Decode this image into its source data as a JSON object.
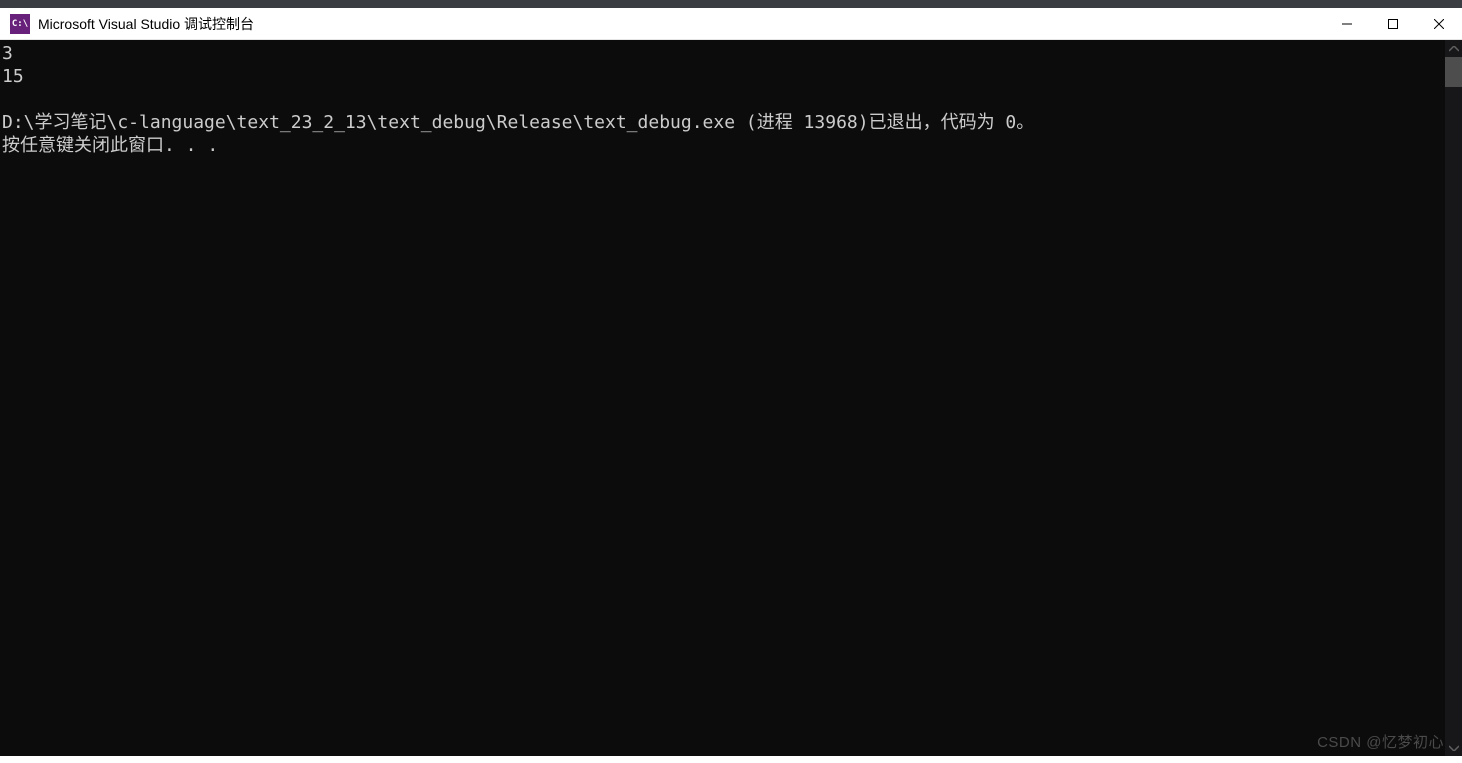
{
  "window": {
    "icon_text": "C:\\",
    "title": "Microsoft Visual Studio 调试控制台"
  },
  "console": {
    "lines": [
      "3",
      "15",
      "",
      "D:\\学习笔记\\c-language\\text_23_2_13\\text_debug\\Release\\text_debug.exe (进程 13968)已退出，代码为 0。",
      "按任意键关闭此窗口. . ."
    ]
  },
  "watermark": "CSDN @忆梦初心"
}
